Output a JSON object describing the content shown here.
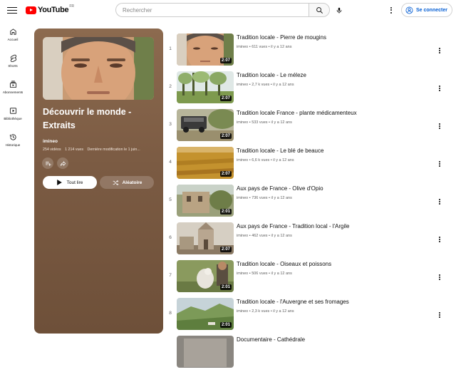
{
  "header": {
    "logo_text": "YouTube",
    "logo_region": "FR",
    "search_placeholder": "Rechercher",
    "signin_label": "Se connecter"
  },
  "sidebar": {
    "items": [
      {
        "label": "Accueil",
        "icon": "home-icon"
      },
      {
        "label": "Shorts",
        "icon": "shorts-icon"
      },
      {
        "label": "Abonnements",
        "icon": "subscriptions-icon"
      },
      {
        "label": "Bibliothèque",
        "icon": "library-icon"
      },
      {
        "label": "Historique",
        "icon": "history-icon"
      }
    ]
  },
  "playlist": {
    "title": "Découvrir le monde - Extraits",
    "channel": "imineo",
    "video_count": "254 vidéos",
    "views": "1 214 vues",
    "modified": "Dernière modification le 1 juin...",
    "play_all_label": "Tout lire",
    "shuffle_label": "Aléatoire",
    "accent_color": "#7b5b43"
  },
  "videos": [
    {
      "index": "1",
      "title": "Tradition locale - Pierre de mougins",
      "channel": "imineo",
      "views": "611 vues",
      "age": "il y a 12 ans",
      "duration": "2:07"
    },
    {
      "index": "2",
      "title": "Tradition locale - Le méleze",
      "channel": "imineo",
      "views": "2,7 k vues",
      "age": "il y a 12 ans",
      "duration": "2:07"
    },
    {
      "index": "3",
      "title": "Tradition locale France - plante médicamenteux",
      "channel": "imineo",
      "views": "533 vues",
      "age": "il y a 12 ans",
      "duration": "2:07"
    },
    {
      "index": "4",
      "title": "Tradition locale - Le blé de beauce",
      "channel": "imineo",
      "views": "6,6 k vues",
      "age": "il y a 12 ans",
      "duration": "2:07"
    },
    {
      "index": "5",
      "title": "Aux pays de France - Olive d'Opio",
      "channel": "imineo",
      "views": "736 vues",
      "age": "il y a 12 ans",
      "duration": "2:01"
    },
    {
      "index": "6",
      "title": "Aux pays de France - Tradition local - l'Argile",
      "channel": "imineo",
      "views": "462 vues",
      "age": "il y a 12 ans",
      "duration": "2:07"
    },
    {
      "index": "7",
      "title": "Tradition locale - Oiseaux et poissons",
      "channel": "imineo",
      "views": "506 vues",
      "age": "il y a 12 ans",
      "duration": "2:01"
    },
    {
      "index": "8",
      "title": "Tradition locale - l'Auvergne et ses fromages",
      "channel": "imineo",
      "views": "2,3 k vues",
      "age": "il y a 12 ans",
      "duration": "2:01"
    },
    {
      "index": "",
      "title": "Documentaire - Cathédrale",
      "channel": "",
      "views": "",
      "age": "",
      "duration": ""
    }
  ]
}
